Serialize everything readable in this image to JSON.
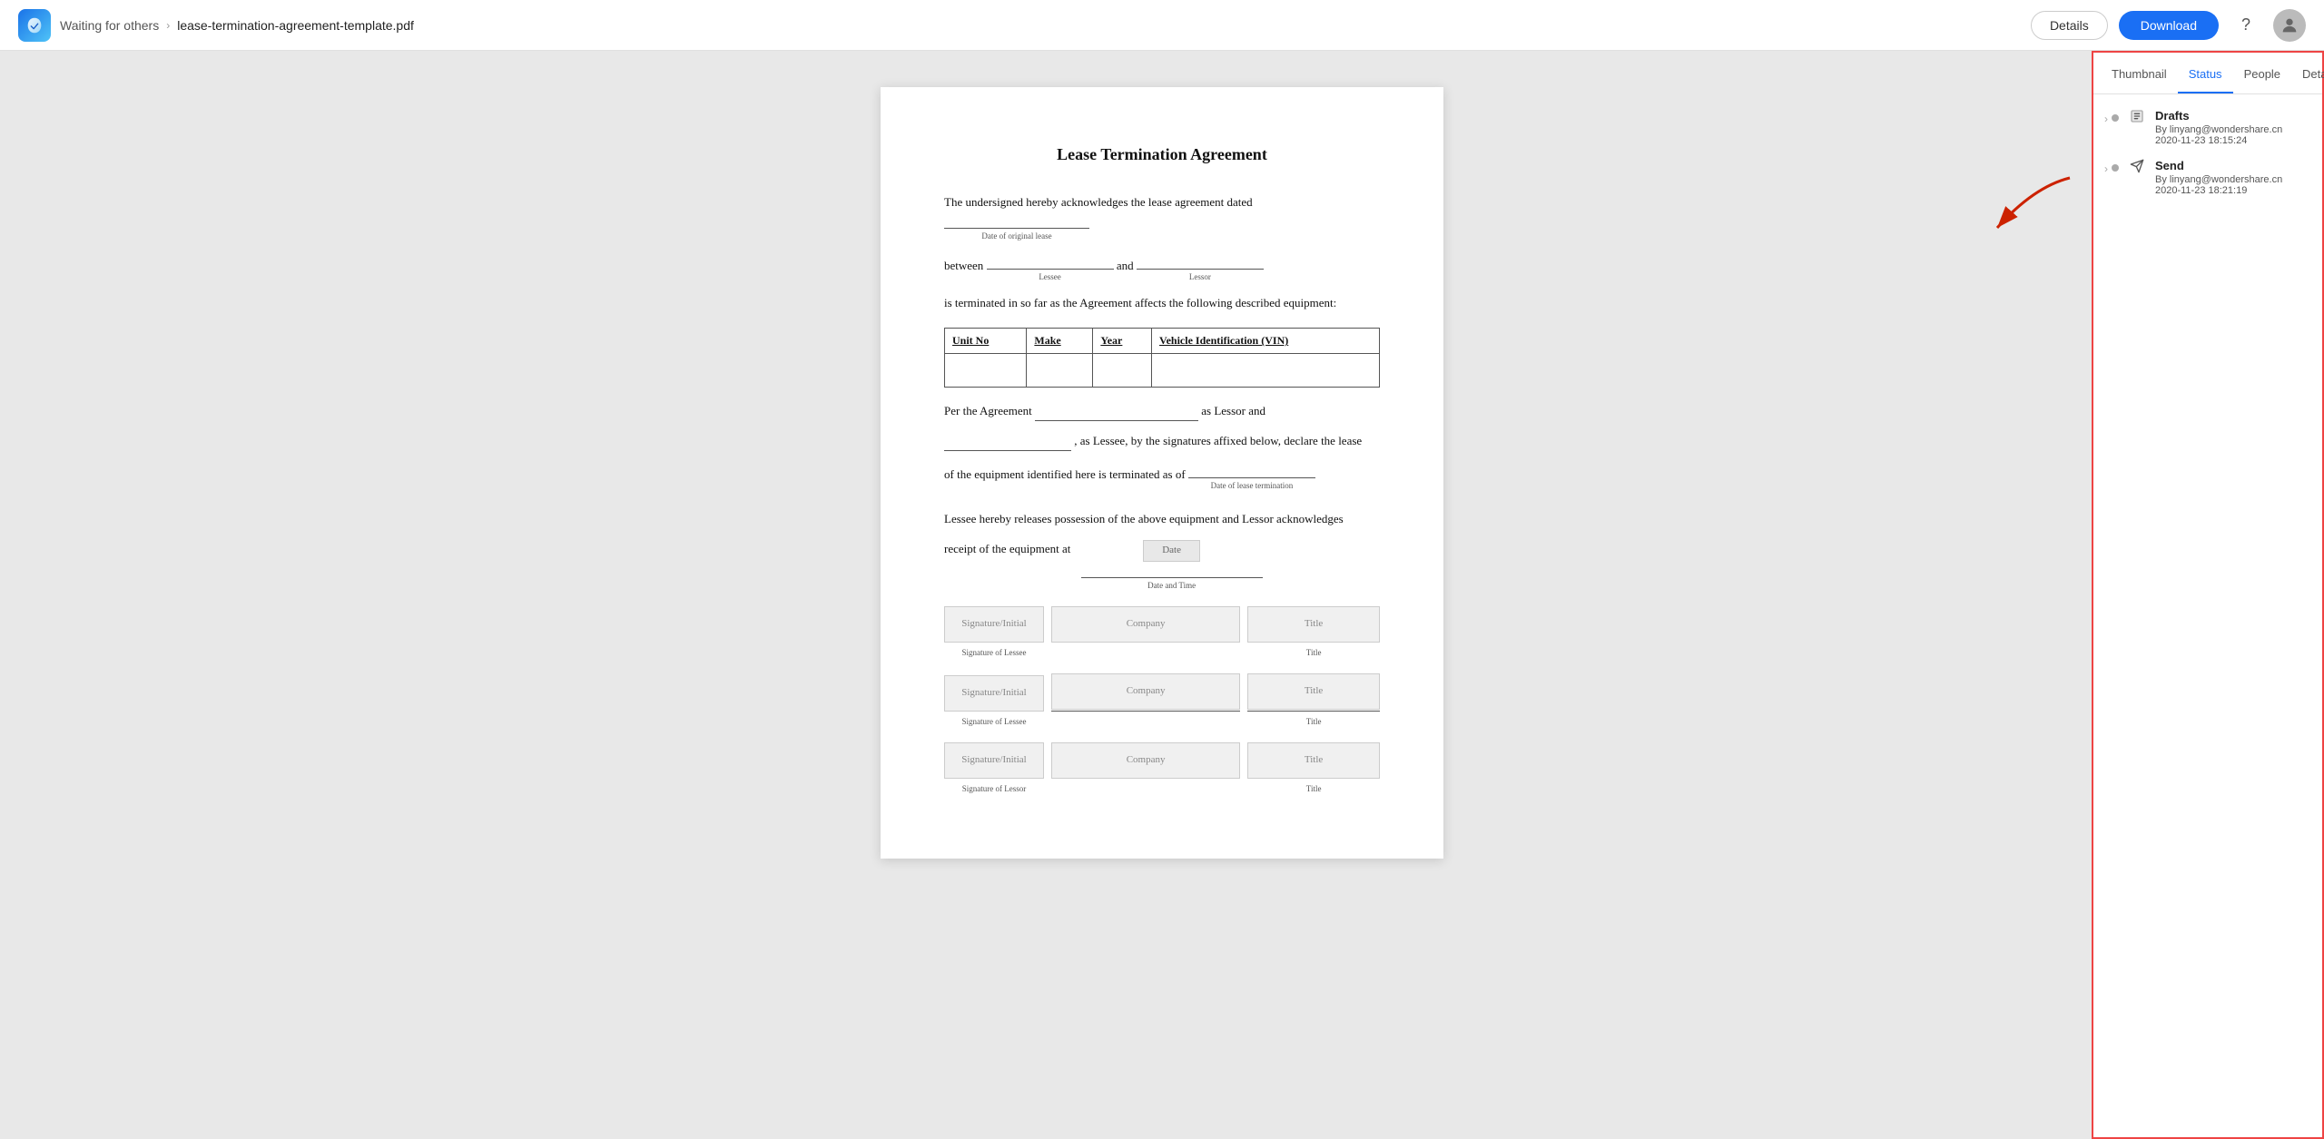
{
  "topbar": {
    "breadcrumb_link": "Waiting for others",
    "breadcrumb_file": "lease-termination-agreement-template.pdf",
    "details_label": "Details",
    "download_label": "Download"
  },
  "panel": {
    "tabs": [
      {
        "id": "thumbnail",
        "label": "Thumbnail"
      },
      {
        "id": "status",
        "label": "Status",
        "active": true
      },
      {
        "id": "people",
        "label": "People"
      },
      {
        "id": "details",
        "label": "Details"
      }
    ],
    "status_items": [
      {
        "id": "drafts",
        "icon": "pencil-icon",
        "title": "Drafts",
        "by": "By linyang@wondershare.cn",
        "time": "2020-11-23 18:15:24"
      },
      {
        "id": "send",
        "icon": "send-icon",
        "title": "Send",
        "by": "By linyang@wondershare.cn",
        "time": "2020-11-23 18:21:19"
      }
    ]
  },
  "pdf": {
    "title": "Lease Termination Agreement",
    "para1": "The undersigned hereby acknowledges the lease agreement dated",
    "para1_label": "Date of original lease",
    "para2_between": "between",
    "para2_and": "and",
    "para2_lessee_label": "Lessee",
    "para2_lessor_label": "Lessor",
    "para3": "is terminated in so far as the Agreement affects the following described equipment:",
    "table_headers": [
      "Unit No",
      "Make",
      "Year",
      "Vehicle Identification (VIN)"
    ],
    "para4": "Per the Agreement",
    "para4b": "as Lessor and",
    "para5": ", as Lessee, by the signatures affixed below, declare the lease",
    "para6": "of the equipment identified here is terminated as of",
    "para6_label": "Date of lease termination",
    "para7": "Lessee hereby releases possession of the above equipment and Lessor acknowledges",
    "para8": "receipt of the equipment at",
    "date_label": "Date",
    "date_time_label": "Date and Time",
    "sig_rows": [
      {
        "sig_label": "Signature/Initial",
        "company_label": "Company",
        "title_label": "Title",
        "bottom_label": "Signature of Lessee"
      },
      {
        "sig_label": "Signature/Initial",
        "company_label": "Company",
        "title_label": "Title",
        "bottom_label": "Signature of Lessee"
      },
      {
        "sig_label": "Signature/Initial",
        "company_label": "Company",
        "title_label": "Title",
        "bottom_label": "Signature of Lessor"
      }
    ]
  }
}
